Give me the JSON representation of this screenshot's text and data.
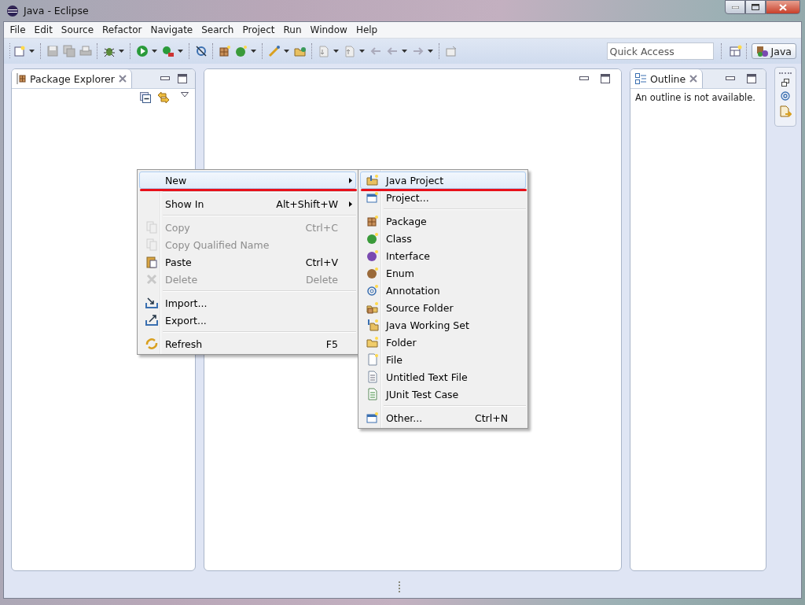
{
  "window": {
    "title": "Java - Eclipse"
  },
  "menu_bar": [
    {
      "label": "File"
    },
    {
      "label": "Edit"
    },
    {
      "label": "Source"
    },
    {
      "label": "Refactor"
    },
    {
      "label": "Navigate"
    },
    {
      "label": "Search"
    },
    {
      "label": "Project"
    },
    {
      "label": "Run"
    },
    {
      "label": "Window"
    },
    {
      "label": "Help"
    }
  ],
  "quick_access": {
    "placeholder": "Quick Access"
  },
  "perspective": {
    "label": "Java",
    "selected": true
  },
  "package_explorer": {
    "tab": "Package Explorer"
  },
  "outline": {
    "tab": "Outline",
    "message": "An outline is not available."
  },
  "context_menu": {
    "items": [
      {
        "kind": "item",
        "label": "New",
        "selected": true,
        "disabled": false,
        "submenu": true
      },
      {
        "kind": "separator"
      },
      {
        "kind": "item",
        "label": "Show In",
        "shortcut": "Alt+Shift+W",
        "selected": false,
        "disabled": false,
        "submenu": true
      },
      {
        "kind": "separator"
      },
      {
        "kind": "item",
        "label": "Copy",
        "shortcut": "Ctrl+C",
        "selected": false,
        "disabled": true,
        "submenu": false
      },
      {
        "kind": "item",
        "label": "Copy Qualified Name",
        "selected": false,
        "disabled": true,
        "submenu": false
      },
      {
        "kind": "item",
        "label": "Paste",
        "shortcut": "Ctrl+V",
        "selected": false,
        "disabled": false,
        "submenu": false
      },
      {
        "kind": "item",
        "label": "Delete",
        "shortcut": "Delete",
        "selected": false,
        "disabled": true,
        "submenu": false
      },
      {
        "kind": "separator"
      },
      {
        "kind": "item",
        "label": "Import...",
        "selected": false,
        "disabled": false,
        "submenu": false
      },
      {
        "kind": "item",
        "label": "Export...",
        "selected": false,
        "disabled": false,
        "submenu": false
      },
      {
        "kind": "separator"
      },
      {
        "kind": "item",
        "label": "Refresh",
        "shortcut": "F5",
        "selected": false,
        "disabled": false,
        "submenu": false
      }
    ]
  },
  "new_submenu": {
    "items": [
      {
        "kind": "item",
        "label": "Java Project",
        "selected": true,
        "disabled": false,
        "submenu": false
      },
      {
        "kind": "item",
        "label": "Project...",
        "selected": false,
        "disabled": false,
        "submenu": false
      },
      {
        "kind": "separator"
      },
      {
        "kind": "item",
        "label": "Package",
        "selected": false,
        "disabled": false,
        "submenu": false
      },
      {
        "kind": "item",
        "label": "Class",
        "selected": false,
        "disabled": false,
        "submenu": false
      },
      {
        "kind": "item",
        "label": "Interface",
        "selected": false,
        "disabled": false,
        "submenu": false
      },
      {
        "kind": "item",
        "label": "Enum",
        "selected": false,
        "disabled": false,
        "submenu": false
      },
      {
        "kind": "item",
        "label": "Annotation",
        "selected": false,
        "disabled": false,
        "submenu": false
      },
      {
        "kind": "item",
        "label": "Source Folder",
        "selected": false,
        "disabled": false,
        "submenu": false
      },
      {
        "kind": "item",
        "label": "Java Working Set",
        "selected": false,
        "disabled": false,
        "submenu": false
      },
      {
        "kind": "item",
        "label": "Folder",
        "selected": false,
        "disabled": false,
        "submenu": false
      },
      {
        "kind": "item",
        "label": "File",
        "selected": false,
        "disabled": false,
        "submenu": false
      },
      {
        "kind": "item",
        "label": "Untitled Text File",
        "selected": false,
        "disabled": false,
        "submenu": false
      },
      {
        "kind": "item",
        "label": "JUnit Test Case",
        "selected": false,
        "disabled": false,
        "submenu": false
      },
      {
        "kind": "separator"
      },
      {
        "kind": "item",
        "label": "Other...",
        "shortcut": "Ctrl+N",
        "selected": false,
        "disabled": false,
        "submenu": false
      }
    ]
  }
}
